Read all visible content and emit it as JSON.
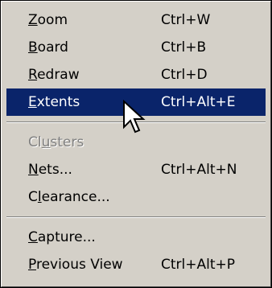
{
  "menu": {
    "items": [
      {
        "pre": "",
        "key": "Z",
        "post": "oom",
        "shortcut": "Ctrl+W"
      },
      {
        "pre": "",
        "key": "B",
        "post": "oard",
        "shortcut": "Ctrl+B"
      },
      {
        "pre": "",
        "key": "R",
        "post": "edraw",
        "shortcut": "Ctrl+D"
      },
      {
        "pre": "",
        "key": "E",
        "post": "xtents",
        "shortcut": "Ctrl+Alt+E"
      },
      {
        "pre": "Cl",
        "key": "u",
        "post": "sters",
        "shortcut": ""
      },
      {
        "pre": "",
        "key": "N",
        "post": "ets...",
        "shortcut": "Ctrl+Alt+N"
      },
      {
        "pre": "C",
        "key": "l",
        "post": "earance...",
        "shortcut": ""
      },
      {
        "pre": "",
        "key": "C",
        "post": "apture...",
        "shortcut": ""
      },
      {
        "pre": "",
        "key": "P",
        "post": "revious View",
        "shortcut": "Ctrl+Alt+P"
      }
    ]
  },
  "colors": {
    "menu_bg": "#d4d0c8",
    "highlight": "#0a246a",
    "disabled_text": "#808080"
  },
  "icons": {
    "cursor": "arrow-pointer-icon"
  }
}
